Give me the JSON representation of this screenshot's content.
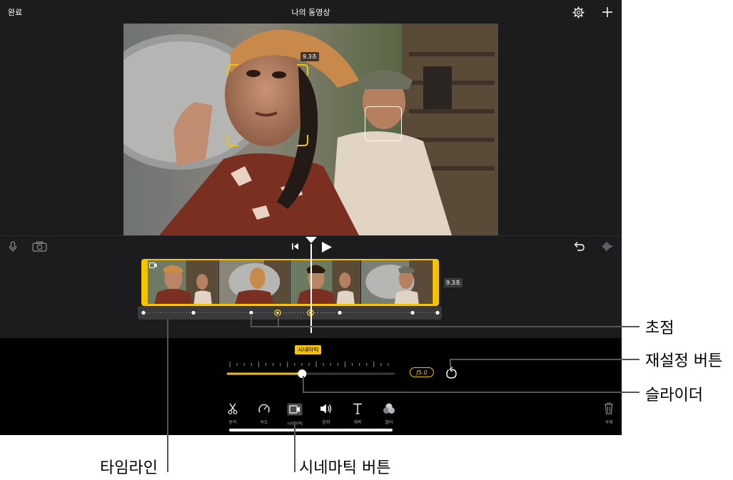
{
  "topbar": {
    "done": "완료",
    "title": "나의 동영상"
  },
  "viewer": {
    "duration_badge": "9.3초"
  },
  "timeline": {
    "duration_badge": "9.3초"
  },
  "cinematic": {
    "tag": "시네마틱",
    "fstop": "ƒ5.0",
    "slider_value": 0.5
  },
  "toolbar": {
    "items": [
      {
        "label": "동작"
      },
      {
        "label": "속도"
      },
      {
        "label": "시네마틱"
      },
      {
        "label": "음량"
      },
      {
        "label": "제목"
      },
      {
        "label": "필터"
      }
    ],
    "delete": "삭제"
  },
  "callouts": {
    "focus": "초점",
    "reset": "재설정 버튼",
    "slider": "슬라이더",
    "timeline": "타임라인",
    "cinematic_button": "시네마틱 버튼"
  },
  "colors": {
    "accent": "#f5c400",
    "background": "#000000",
    "panel": "#1c1c1e"
  }
}
